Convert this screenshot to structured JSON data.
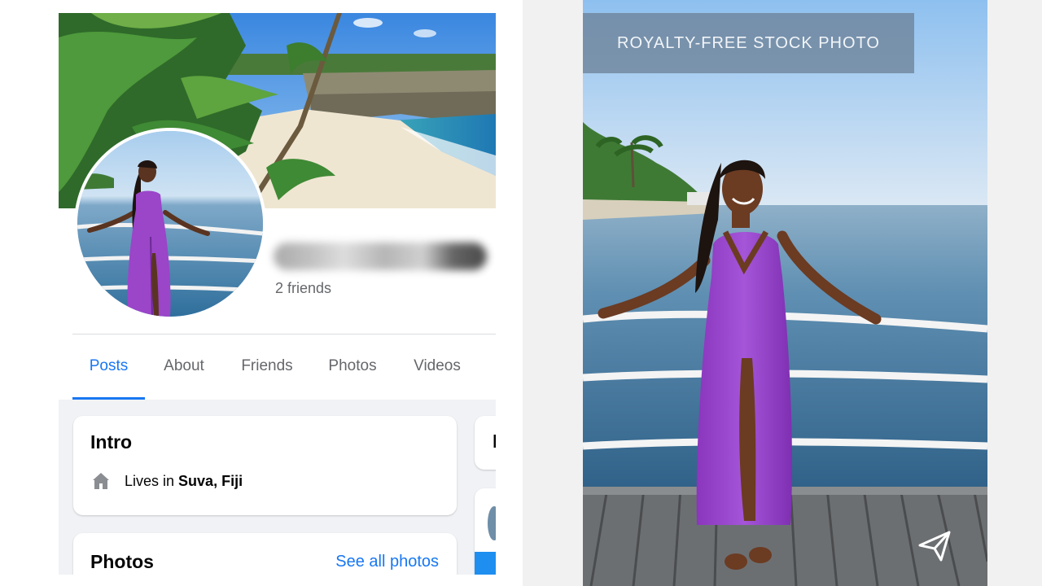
{
  "profile": {
    "friends_count": "2 friends"
  },
  "tabs": [
    {
      "label": "Posts",
      "active": true
    },
    {
      "label": "About",
      "active": false
    },
    {
      "label": "Friends",
      "active": false
    },
    {
      "label": "Photos",
      "active": false
    },
    {
      "label": "Videos",
      "active": false
    }
  ],
  "intro": {
    "title": "Intro",
    "lives_prefix": "Lives in",
    "lives_place": "Suva, Fiji",
    "icon": "home-icon"
  },
  "photos": {
    "title": "Photos",
    "see_all": "See all photos"
  },
  "side_card": {
    "title_initial": "I"
  },
  "stock": {
    "banner": "ROYALTY-FREE STOCK PHOTO",
    "share_icon": "paper-plane-icon"
  },
  "colors": {
    "accent": "#1877f2",
    "secondary_text": "#65676b",
    "page_bg": "#f0f2f5",
    "dress": "#9b45c9"
  }
}
